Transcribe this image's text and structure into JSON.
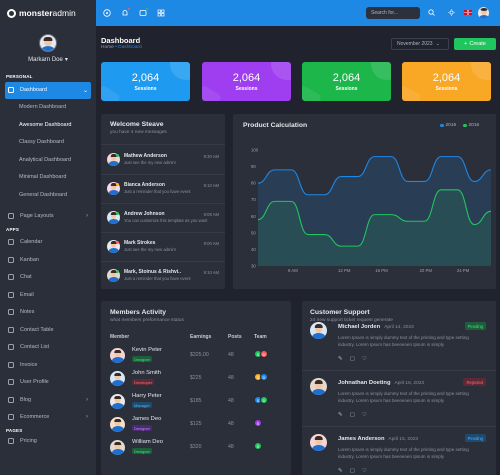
{
  "app": {
    "brand_bold": "monster",
    "brand_rest": "admin"
  },
  "profile": {
    "name": "Markarn Doe",
    "caret": "▾"
  },
  "sidebar": {
    "personal_label": "PERSONAL",
    "dashboard": {
      "label": "Dashboard",
      "icon": "home-icon"
    },
    "sub_items": [
      "Modern Dashboard",
      "Awesome Dashboard",
      "Classy Dashboard",
      "Analytical Dashboard",
      "Minimal Dashboard",
      "General Dashboard"
    ],
    "page_layouts": "Page Layouts",
    "apps_label": "APPS",
    "apps": [
      {
        "label": "Calendar",
        "icon": "calendar-icon",
        "arrow": false
      },
      {
        "label": "Kanban",
        "icon": "kanban-icon",
        "arrow": false
      },
      {
        "label": "Chat",
        "icon": "chat-icon",
        "arrow": false
      },
      {
        "label": "Email",
        "icon": "email-icon",
        "arrow": false
      },
      {
        "label": "Notes",
        "icon": "notes-icon",
        "arrow": false
      },
      {
        "label": "Contact Table",
        "icon": "contact-table-icon",
        "arrow": false
      },
      {
        "label": "Contact List",
        "icon": "contact-list-icon",
        "arrow": false
      },
      {
        "label": "Invoice",
        "icon": "invoice-icon",
        "arrow": false
      },
      {
        "label": "User Profile",
        "icon": "user-icon",
        "arrow": false
      },
      {
        "label": "Blog",
        "icon": "blog-icon",
        "arrow": true
      },
      {
        "label": "Ecommerce",
        "icon": "cart-icon",
        "arrow": true
      }
    ],
    "pages_label": "PAGES",
    "pages": [
      {
        "label": "Pricing",
        "icon": "pricing-icon"
      }
    ]
  },
  "topbar": {
    "search_placeholder": "Search for..."
  },
  "page": {
    "title": "Dashboard",
    "crumb_home": "Home",
    "crumb_sep": "•",
    "crumb_current": "Dashboard"
  },
  "controls": {
    "month": "November 2023",
    "create": "Create"
  },
  "stats": [
    {
      "value": "2,064",
      "label": "Sessions",
      "color": "#1e9bf0"
    },
    {
      "value": "2,064",
      "label": "Sessions",
      "color": "#9f3ef0"
    },
    {
      "value": "2,064",
      "label": "Sessions",
      "color": "#1cb64b"
    },
    {
      "value": "2,064",
      "label": "Sessions",
      "color": "#f9a826"
    }
  ],
  "welcome": {
    "title": "Welcome Steave",
    "subtitle": "you have 4 new messages",
    "messages": [
      {
        "name": "Mathew Anderson",
        "text": "Just see the my new admin!",
        "time": "9:30 AM",
        "status": "#21c55d",
        "bg": "#f4d6d6"
      },
      {
        "name": "Bianca Anderson",
        "text": "Just a reminder that you have event",
        "time": "9:10 AM",
        "status": "#ffb020",
        "bg": "#f7d6ee"
      },
      {
        "name": "Andrew Johnson",
        "text": "You can customize this template as you want",
        "time": "9:08 AM",
        "status": "#21c55d",
        "bg": "#d9e8f6"
      },
      {
        "name": "Mark Strokes",
        "text": "Just see the my new admin!",
        "time": "9:00 AM",
        "status": "#ff5a5f",
        "bg": "#e9e9e9"
      },
      {
        "name": "Mark, Stoinus & Rishvi..",
        "text": "Just a reminder that you have event",
        "time": "9:10 AM",
        "status": "#21c55d",
        "bg": "#e4d9cc"
      }
    ]
  },
  "product_calc": {
    "title": "Product Calculation",
    "legend": [
      {
        "label": "2016",
        "color": "#1e88e5"
      },
      {
        "label": "2016",
        "color": "#21c55d"
      }
    ]
  },
  "chart_data": {
    "type": "area",
    "title": "Product Calculation",
    "x_ticks": [
      "8 AM",
      "12 PM",
      "16 PM",
      "20 PM",
      "24 PM"
    ],
    "x": [
      0,
      1,
      2,
      3,
      4,
      5,
      6,
      7,
      8,
      9,
      10,
      11,
      12,
      13,
      14
    ],
    "ylim": [
      30,
      100
    ],
    "y_ticks": [
      30,
      40,
      50,
      60,
      70,
      80,
      90,
      100
    ],
    "series": [
      {
        "name": "2016",
        "color": "#1e88e5",
        "values": [
          80,
          88,
          88,
          73,
          73,
          84,
          84,
          96,
          96,
          81,
          81,
          96,
          96,
          81,
          88
        ]
      },
      {
        "name": "2016",
        "color": "#21c55d",
        "values": [
          58,
          69,
          69,
          49,
          49,
          42,
          42,
          61,
          61,
          57,
          57,
          76,
          76,
          55,
          63
        ]
      }
    ]
  },
  "members": {
    "title": "Members Activity",
    "subtitle": "what members preformance status",
    "columns": [
      "Member",
      "Earnings",
      "Posts",
      "Team"
    ],
    "rows": [
      {
        "name": "Kevin Peter",
        "role": "Designer",
        "role_bg": "#1e5e3a",
        "role_fg": "#3ee07a",
        "earnings": "$325.00",
        "posts": "48",
        "team": [
          {
            "t": "S",
            "c": "#21c55d"
          },
          {
            "t": "D",
            "c": "#ff5a5f"
          }
        ],
        "bg": "#f4d6d6"
      },
      {
        "name": "John Smith",
        "role": "Developer",
        "role_bg": "#5a2a36",
        "role_fg": "#ff6a7a",
        "earnings": "$225",
        "posts": "48",
        "team": [
          {
            "t": "S",
            "c": "#ffb020"
          },
          {
            "t": "D",
            "c": "#1e88e5"
          }
        ],
        "bg": "#d9e8f6"
      },
      {
        "name": "Harry Peter",
        "role": "Manager",
        "role_bg": "#1e4a6e",
        "role_fg": "#4db0ff",
        "earnings": "$185",
        "posts": "48",
        "team": [
          {
            "t": "S",
            "c": "#1e88e5"
          },
          {
            "t": "D",
            "c": "#21c55d"
          }
        ],
        "bg": "#e9e9e9"
      },
      {
        "name": "James Deo",
        "role": "Designer",
        "role_bg": "#4a2a70",
        "role_fg": "#c486ff",
        "earnings": "$125",
        "posts": "48",
        "team": [
          {
            "t": "S",
            "c": "#9f3ef0"
          }
        ],
        "bg": "#f7e0c8"
      },
      {
        "name": "William Deo",
        "role": "Designer",
        "role_bg": "#1e5e3a",
        "role_fg": "#3ee07a",
        "earnings": "$320",
        "posts": "48",
        "team": [
          {
            "t": "S",
            "c": "#21c55d"
          }
        ],
        "bg": "#e4d9cc"
      }
    ]
  },
  "support": {
    "title": "Customer Support",
    "subtitle": "24 new support ticket request generate",
    "tickets": [
      {
        "name": "Michael Jorden",
        "date": "April 14, 2023",
        "status": "Pending",
        "status_bg": "#1e5e3a",
        "status_fg": "#3ee07a",
        "body": "Lorem Ipsum is simply dummy text of the printing and type setting industry. Lorem Ipsum has beenenen Ipsum is simply",
        "bg": "#d9e8f6"
      },
      {
        "name": "Johnathan Doeting",
        "date": "April 16, 2023",
        "status": "Rejected",
        "status_bg": "#5a2a36",
        "status_fg": "#ff6a7a",
        "body": "Lorem Ipsum is simply dummy text of the printing and type setting industry. Lorem Ipsum has beenenen Ipsum is simply",
        "bg": "#e4d9cc"
      },
      {
        "name": "James Anderson",
        "date": "April 15, 2023",
        "status": "Pending",
        "status_bg": "#1e4a6e",
        "status_fg": "#4db0ff",
        "body": "Lorem Ipsum is simply dummy text of the printing and type setting industry. Lorem Ipsum has beenenen Ipsum is simply",
        "bg": "#f4d6d6"
      }
    ]
  }
}
